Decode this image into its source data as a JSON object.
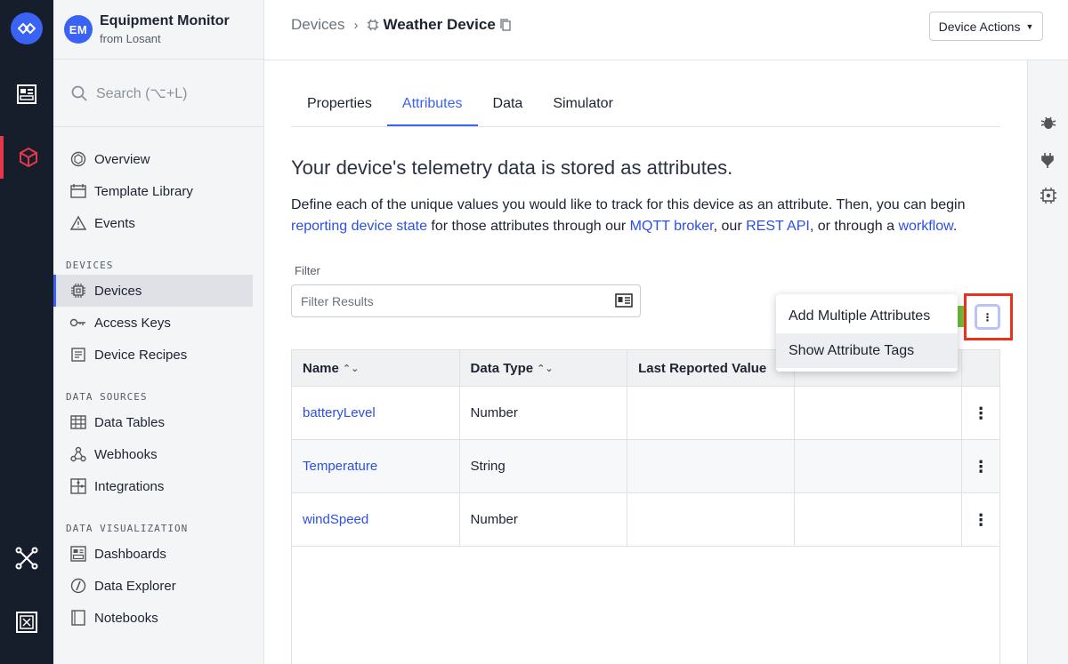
{
  "app": {
    "initials": "EM",
    "title": "Equipment Monitor",
    "subtitle": "from Losant"
  },
  "search": {
    "placeholder": "Search (⌥+L)"
  },
  "nav": {
    "top": [
      {
        "label": "Overview",
        "icon": "overview-icon"
      },
      {
        "label": "Template Library",
        "icon": "template-library-icon"
      },
      {
        "label": "Events",
        "icon": "warning-icon"
      }
    ],
    "sections": [
      {
        "heading": "DEVICES",
        "items": [
          {
            "label": "Devices",
            "icon": "chip-icon",
            "active": true
          },
          {
            "label": "Access Keys",
            "icon": "key-icon"
          },
          {
            "label": "Device Recipes",
            "icon": "recipe-icon"
          }
        ]
      },
      {
        "heading": "DATA SOURCES",
        "items": [
          {
            "label": "Data Tables",
            "icon": "table-icon"
          },
          {
            "label": "Webhooks",
            "icon": "webhook-icon"
          },
          {
            "label": "Integrations",
            "icon": "puzzle-icon"
          }
        ]
      },
      {
        "heading": "DATA VISUALIZATION",
        "items": [
          {
            "label": "Dashboards",
            "icon": "dashboard-icon"
          },
          {
            "label": "Data Explorer",
            "icon": "compass-icon"
          },
          {
            "label": "Notebooks",
            "icon": "notebook-icon"
          }
        ]
      }
    ]
  },
  "breadcrumb": {
    "parent": "Devices",
    "separator": "›",
    "current": "Weather Device"
  },
  "header": {
    "actions_label": "Device Actions"
  },
  "tabs": [
    "Properties",
    "Attributes",
    "Data",
    "Simulator"
  ],
  "active_tab": "Attributes",
  "content": {
    "heading": "Your device's telemetry data is stored as attributes.",
    "desc_1": "Define each of the unique values you would like to track for this device as an attribute. Then, you can begin ",
    "link_1": "reporting device state",
    "desc_2": " for those attributes through our ",
    "link_2": "MQTT broker",
    "desc_3": ", our ",
    "link_3": "REST API",
    "desc_4": ", or through a ",
    "link_4": "workflow",
    "desc_5": "."
  },
  "filter": {
    "label": "Filter",
    "placeholder": "Filter Results"
  },
  "table": {
    "columns": [
      "Name",
      "Data Type",
      "Last Reported Value",
      ""
    ],
    "rows": [
      {
        "name": "batteryLevel",
        "type": "Number"
      },
      {
        "name": "Temperature",
        "type": "String"
      },
      {
        "name": "windSpeed",
        "type": "Number"
      }
    ]
  },
  "menu": {
    "items": [
      "Add Multiple Attributes",
      "Show Attribute Tags"
    ]
  },
  "colors": {
    "accent": "#3a63f5",
    "rail": "#161d2b",
    "highlight": "#e8321c",
    "link": "#2b4fe8"
  }
}
